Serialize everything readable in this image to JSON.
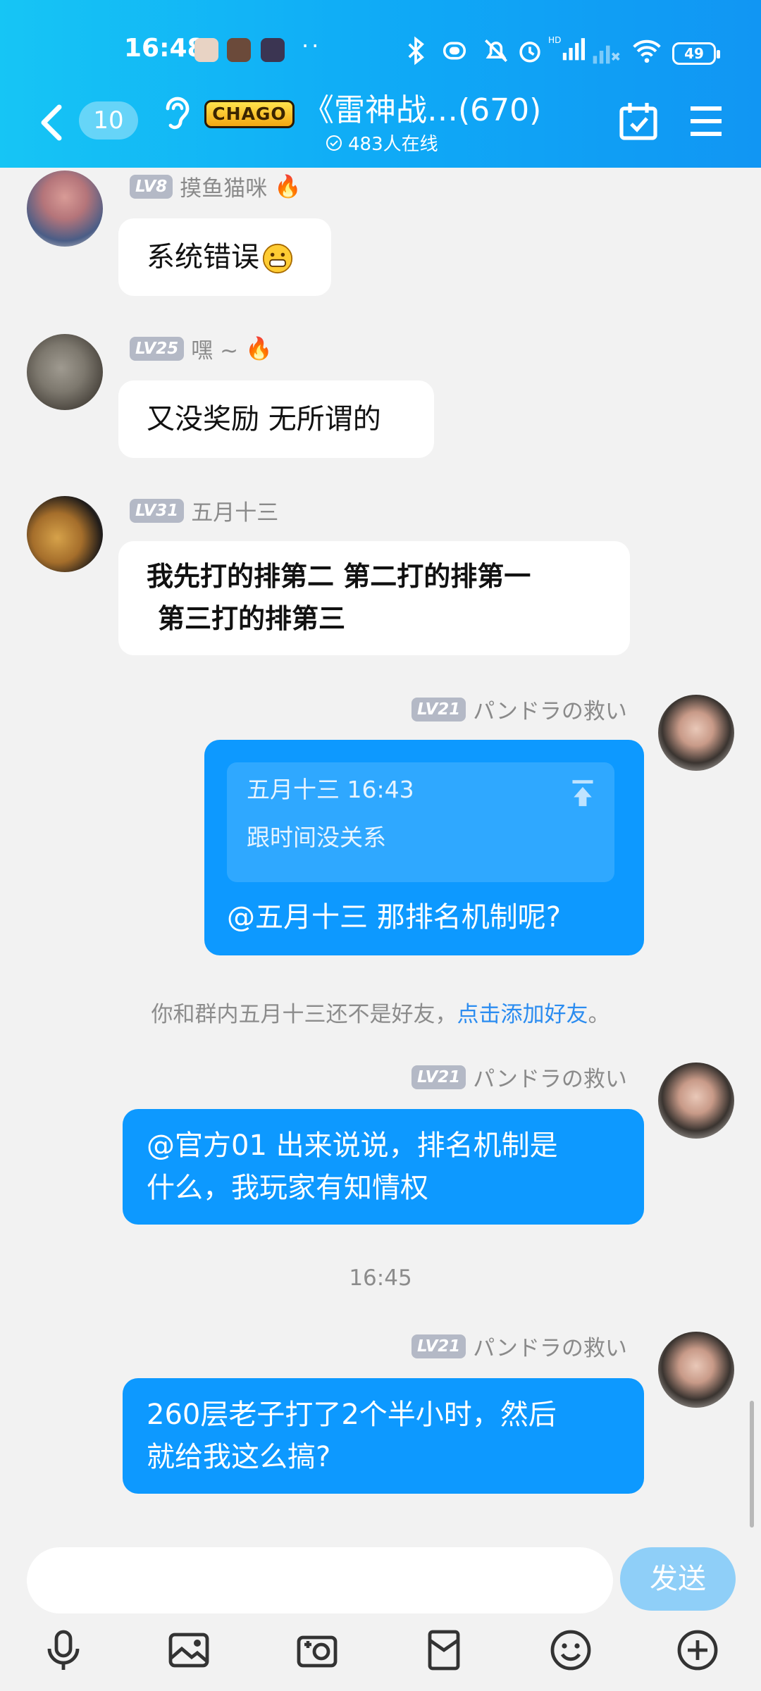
{
  "status_bar": {
    "time": "16:48",
    "battery": "49",
    "icons": [
      "bluetooth-icon",
      "vibrate-icon",
      "mute-icon",
      "alarm-icon",
      "hd-signal-icon",
      "signal-icon",
      "wifi-icon",
      "battery-icon"
    ]
  },
  "header": {
    "unread_count": "10",
    "group_logo_text": "CHAGO",
    "title": "《雷神战…(670)",
    "online": "483人在线"
  },
  "messages": [
    {
      "side": "in",
      "level": "LV8",
      "name": "摸鱼猫咪",
      "text": "系统错误"
    },
    {
      "side": "in",
      "level": "LV25",
      "name": "嘿 ~",
      "text": "又没奖励 无所谓的"
    },
    {
      "side": "in",
      "level": "LV31",
      "name": "五月十三",
      "text_line1": "我先打的排第二 第二打的排第一",
      "text_line2": "第三打的排第三"
    },
    {
      "side": "out",
      "level": "LV21",
      "name": "パンドラの救い",
      "quote_header": "五月十三 16:43",
      "quote_text": "跟时间没关系",
      "text": "@五月十三 那排名机制呢?"
    },
    {
      "side": "out",
      "level": "LV21",
      "name": "パンドラの救い",
      "text_line1": "@官方01 出来说说，排名机制是",
      "text_line2": "什么，我玩家有知情权"
    },
    {
      "side": "out",
      "level": "LV21",
      "name": "パンドラの救い",
      "text_line1": "260层老子打了2个半小时，然后",
      "text_line2": "就给我这么搞?"
    }
  ],
  "notice": {
    "text": "你和群内五月十三还不是好友，",
    "link": "点击添加好友",
    "end": "。"
  },
  "timestamp": "16:45",
  "input": {
    "placeholder": "",
    "send_label": "发送"
  },
  "toolbar": [
    "microphone-icon",
    "image-icon",
    "camera-icon",
    "red-packet-icon",
    "emoji-icon",
    "plus-icon"
  ],
  "colors": {
    "header_start": "#16c5f5",
    "header_end": "#1196f3",
    "bubble_out": "#0d99ff",
    "link": "#2b8cf0"
  }
}
